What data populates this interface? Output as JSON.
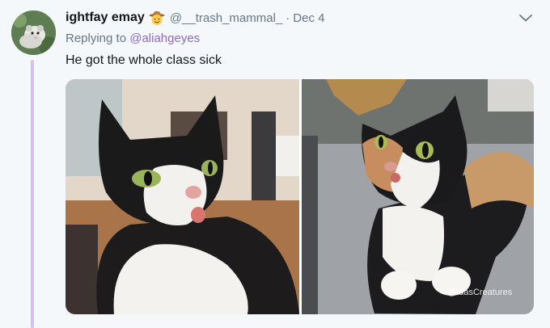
{
  "tweet": {
    "display_name": "ightfay emay",
    "emoji_icon": "cowboy-face-icon",
    "handle": "@__trash_mammal_",
    "separator": "·",
    "date": "Dec 4",
    "replying_prefix": "Replying to ",
    "replying_to": "@aliahgeyes",
    "text": "He got the whole class sick",
    "menu_icon": "chevron-down-icon"
  },
  "media": {
    "right_watermark": "@IdasCreatures"
  },
  "colors": {
    "background": "#f5f8fa",
    "text": "#14171a",
    "muted": "#657786",
    "link": "#8b68c8",
    "thread_line": "#d6c1eb"
  }
}
